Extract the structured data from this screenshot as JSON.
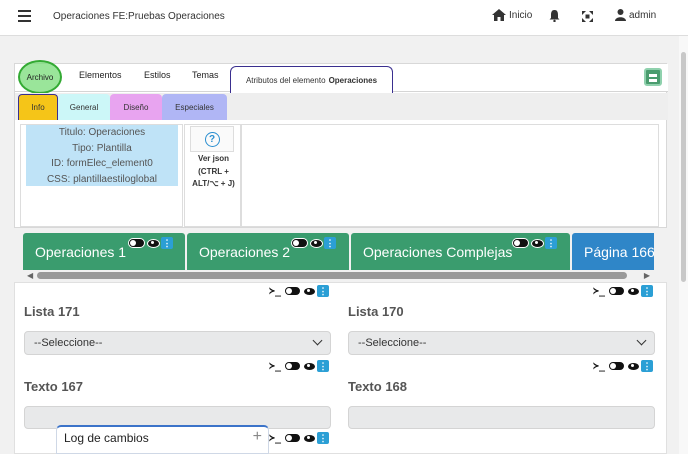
{
  "header": {
    "title": "Operaciones FE:Pruebas Operaciones",
    "home_label": "Inicio",
    "user_label": "admin"
  },
  "tabs": {
    "archivo": "Archivo",
    "elementos": "Elementos",
    "estilos": "Estilos",
    "temas": "Temas",
    "attr_prefix": "Atributos del elemento",
    "attr_name": "Operaciones"
  },
  "subtabs": {
    "info": "Info",
    "general": "General",
    "diseno": "Diseño",
    "especiales": "Especiales"
  },
  "info": {
    "titulo": "Titulo: Operaciones",
    "tipo": "Tipo: Plantilla",
    "id": "ID: formElec_element0",
    "css": "CSS: plantillaestiloglobal"
  },
  "json": {
    "help": "?",
    "line1": "Ver json",
    "line2": "(CTRL +",
    "line3": "ALT/⌥ + J)"
  },
  "pages": [
    {
      "label": "Operaciones 1"
    },
    {
      "label": "Operaciones 2"
    },
    {
      "label": "Operaciones Complejas"
    },
    {
      "label": "Página 166"
    }
  ],
  "form": {
    "lista171": "Lista 171",
    "lista170": "Lista 170",
    "select_placeholder": "--Seleccione--",
    "texto167": "Texto 167",
    "texto168": "Texto 168",
    "prompt": "≻_"
  },
  "log": {
    "label": "Log de cambios",
    "plus": "+"
  },
  "colors": {
    "green": "#3a9c6e",
    "blue": "#2f86c8",
    "info_tab": "#f5c518",
    "general_tab": "#ccf7f8",
    "diseno_tab": "#e8a4f0",
    "especiales_tab": "#b0b6f5"
  }
}
